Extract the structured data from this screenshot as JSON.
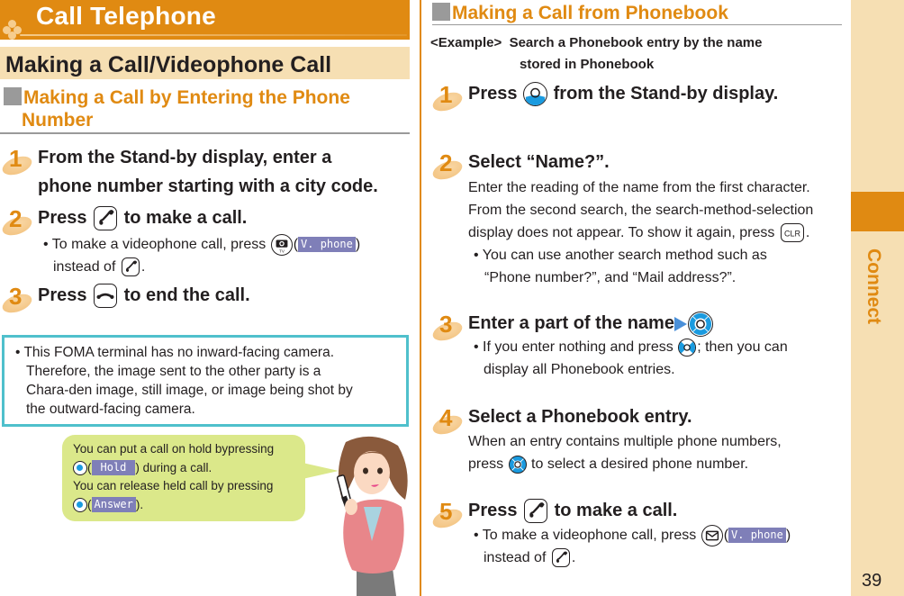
{
  "header": {
    "chapter_title": "Call Telephone",
    "section_title": "Making a Call/Videophone Call"
  },
  "left": {
    "subhead_line1": "Making a Call by Entering the Phone",
    "subhead_line2": "Number",
    "steps": [
      {
        "num": "1",
        "line1": "From the Stand-by display, enter a",
        "line2": "phone number starting with a city code."
      },
      {
        "num": "2",
        "prefix": "Press",
        "suffix": "to make a call.",
        "bullet_prefix": "• To make a videophone call, press",
        "soft_key": "V. phone",
        "bullet_line2_prefix": "instead of",
        "bullet_line2_suffix": "."
      },
      {
        "num": "3",
        "prefix": "Press",
        "suffix": "to end the call."
      }
    ],
    "note": {
      "line1": "• This FOMA terminal has no inward-facing camera.",
      "line2": "Therefore, the image sent to the other party is a",
      "line3": "Chara-den image, still image, or image being shot by",
      "line4": "the outward-facing camera."
    },
    "bubble": {
      "line1": "You can put a call on hold bypressing",
      "hold_label": "Hold",
      "line2_suffix": ") during a call.",
      "line3": "You can release held call by pressing",
      "answer_label": "Answer",
      "line4_suffix": ")."
    }
  },
  "right": {
    "subhead": "Making a Call from Phonebook",
    "example_label": "<Example>",
    "example_line1": "Search a Phonebook entry by the name",
    "example_line2": "stored in Phonebook",
    "steps": [
      {
        "num": "1",
        "prefix": "Press",
        "suffix": "from the Stand-by display."
      },
      {
        "num": "2",
        "title": "Select “Name?”.",
        "body1": "Enter the reading of the name from the first character.",
        "body2": "From the second search, the search-method-selection",
        "body3_prefix": "display does not appear. To show it again, press",
        "body3_suffix": ".",
        "bullet1": "• You can use another search method such as",
        "bullet2": "“Phone number?”, and “Mail address?”."
      },
      {
        "num": "3",
        "title": "Enter a part of the name",
        "bullet1_prefix": "• If you enter nothing and press",
        "bullet1_suffix": "; then you can",
        "bullet2": "display all Phonebook entries."
      },
      {
        "num": "4",
        "title": "Select a Phonebook entry.",
        "body1": "When an entry contains multiple phone numbers,",
        "body2_prefix": "press",
        "body2_suffix": "to select a desired phone number."
      },
      {
        "num": "5",
        "prefix": "Press",
        "suffix": "to make a call.",
        "bullet_prefix": "• To make a videophone call, press",
        "soft_key": "V. phone",
        "bullet_line2_prefix": "instead of",
        "bullet_line2_suffix": "."
      }
    ]
  },
  "side_tab": {
    "label": "Connect"
  },
  "page_number": "39",
  "icons": {
    "send_key": "phone-send-key-icon",
    "end_key": "phone-end-key-icon",
    "camera_key": "camera-tv-key-icon",
    "mail_key": "mail-key-icon",
    "nav_key": "navigation-key-icon",
    "clr_key": "clr-key-icon",
    "clr_text": "CLR"
  },
  "colors": {
    "accent_orange": "#e08a12",
    "band_beige": "#f6dfb3",
    "note_border": "#4fc0cc",
    "bubble_green": "#dbe88a",
    "soft_key_purple": "#7f7fb8",
    "nav_blue": "#1a9be0"
  }
}
